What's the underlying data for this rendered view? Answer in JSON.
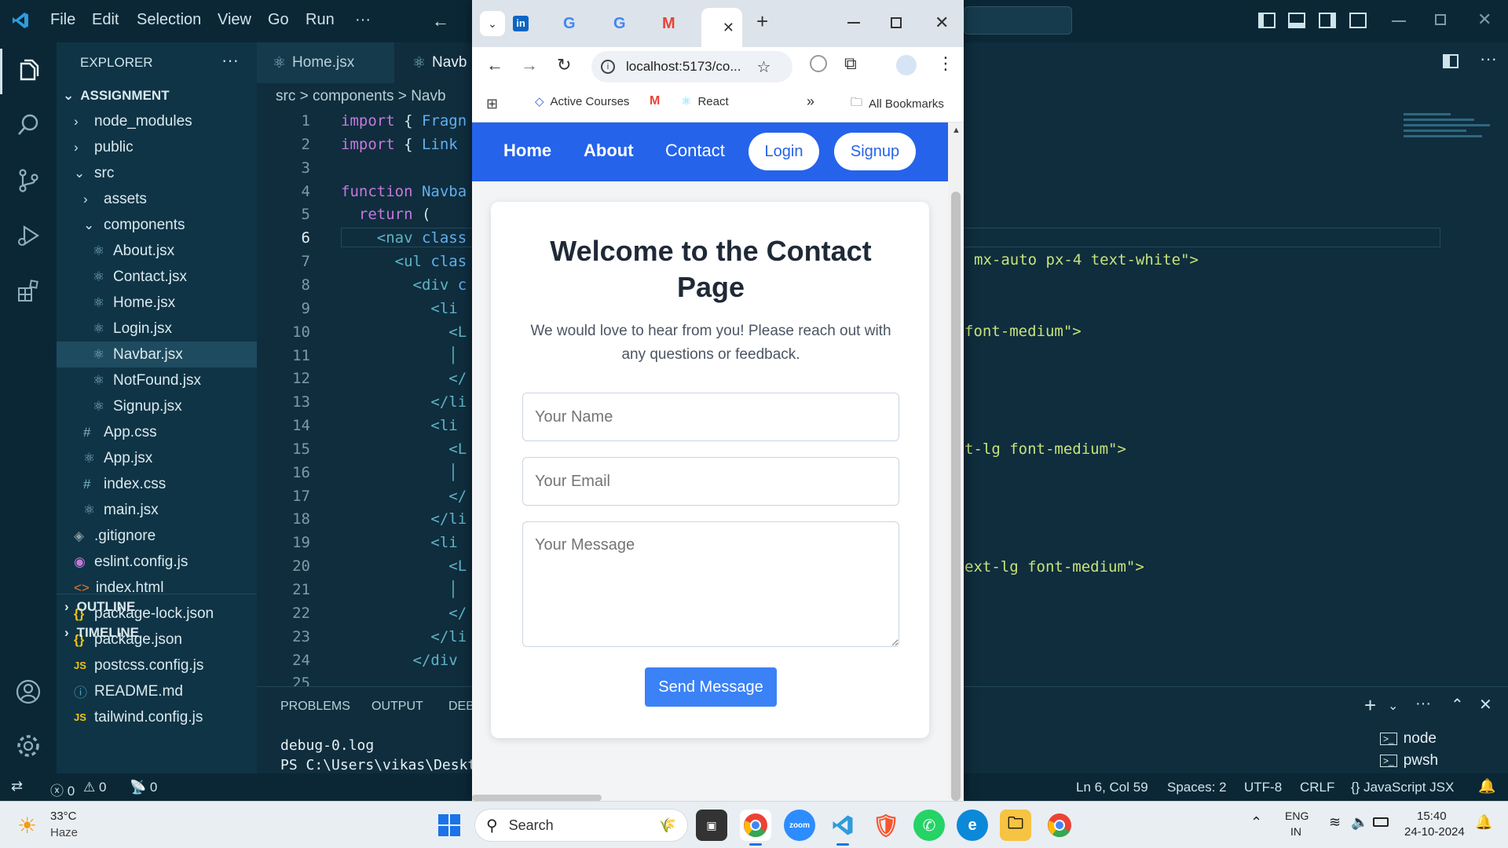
{
  "vscode": {
    "menu": [
      "File",
      "Edit",
      "Selection",
      "View",
      "Go",
      "Run",
      "···"
    ],
    "explorer_title": "EXPLORER",
    "explorer_more": "···",
    "project": "ASSIGNMENT",
    "tree": [
      {
        "label": "node_modules",
        "icon": "chevron-right"
      },
      {
        "label": "public",
        "icon": "chevron-right"
      },
      {
        "label": "src",
        "icon": "chevron-down"
      },
      {
        "label": "assets",
        "icon": "chevron-right"
      },
      {
        "label": "components",
        "icon": "chevron-down"
      },
      {
        "label": "About.jsx",
        "icon": "react"
      },
      {
        "label": "Contact.jsx",
        "icon": "react"
      },
      {
        "label": "Home.jsx",
        "icon": "react"
      },
      {
        "label": "Login.jsx",
        "icon": "react"
      },
      {
        "label": "Navbar.jsx",
        "icon": "react"
      },
      {
        "label": "NotFound.jsx",
        "icon": "react"
      },
      {
        "label": "Signup.jsx",
        "icon": "react"
      },
      {
        "label": "App.css",
        "icon": "hash"
      },
      {
        "label": "App.jsx",
        "icon": "react"
      },
      {
        "label": "index.css",
        "icon": "hash"
      },
      {
        "label": "main.jsx",
        "icon": "react"
      },
      {
        "label": ".gitignore",
        "icon": "diamond"
      },
      {
        "label": "eslint.config.js",
        "icon": "circle"
      },
      {
        "label": "index.html",
        "icon": "html"
      },
      {
        "label": "package-lock.json",
        "icon": "braces"
      },
      {
        "label": "package.json",
        "icon": "braces"
      },
      {
        "label": "postcss.config.js",
        "icon": "js"
      },
      {
        "label": "README.md",
        "icon": "info"
      },
      {
        "label": "tailwind.config.js",
        "icon": "js"
      }
    ],
    "outline": "OUTLINE",
    "timeline": "TIMELINE",
    "tabs": [
      "Home.jsx",
      "Navb"
    ],
    "breadcrumb": [
      "src",
      ">",
      "components",
      ">",
      "Navb"
    ],
    "line_numbers": [
      "1",
      "2",
      "3",
      "4",
      "5",
      "6",
      "7",
      "8",
      "9",
      "10",
      "11",
      "12",
      "13",
      "14",
      "15",
      "16",
      "17",
      "18",
      "19",
      "20",
      "21",
      "22",
      "23",
      "24",
      "25"
    ],
    "code_left": [
      [
        "import",
        " { ",
        "Fragn"
      ],
      [
        "import",
        " { ",
        "Link"
      ],
      [
        "",
        "",
        ""
      ],
      [
        "function",
        " ",
        "Navba"
      ],
      [
        "  return",
        " (",
        ""
      ],
      [
        "    <nav",
        " ",
        "class"
      ],
      [
        "      <ul",
        " ",
        "clas"
      ],
      [
        "        <div",
        " ",
        "c"
      ],
      [
        "          <li",
        "",
        ""
      ],
      [
        "            <L",
        "",
        ""
      ],
      [
        "            │",
        "",
        ""
      ],
      [
        "            </",
        "",
        ""
      ],
      [
        "          </li",
        "",
        ""
      ],
      [
        "          <li",
        "",
        ""
      ],
      [
        "            <L",
        "",
        ""
      ],
      [
        "            │",
        "",
        ""
      ],
      [
        "            </",
        "",
        ""
      ],
      [
        "          </li",
        "",
        ""
      ],
      [
        "          <li",
        "",
        ""
      ],
      [
        "            <L",
        "",
        ""
      ],
      [
        "            │",
        "",
        ""
      ],
      [
        "            </",
        "",
        ""
      ],
      [
        "          </li",
        "",
        ""
      ],
      [
        "        </div",
        "",
        ""
      ]
    ],
    "code_right": {
      "line7": "mx-auto px-4 text-white\">",
      "line10": "font-medium\">",
      "line15": "t-lg font-medium\">",
      "line20": "ext-lg font-medium\">"
    },
    "panel_tabs": [
      "PROBLEMS",
      "OUTPUT",
      "DEB"
    ],
    "terminal": [
      "debug-0.log",
      "PS C:\\Users\\vikas\\Deskt"
    ],
    "terminals": [
      "node",
      "pwsh"
    ],
    "status_left": [
      "0",
      "0",
      "0"
    ],
    "status_right": [
      "Ln 6, Col 59",
      "Spaces: 2",
      "UTF-8",
      "CRLF",
      "{} JavaScript JSX"
    ]
  },
  "browser": {
    "address": "localhost:5173/co...",
    "bookmarks": [
      "Active Courses",
      "React",
      "All Bookmarks"
    ],
    "bookmarks_more": "»",
    "tab_new": "+",
    "nav": {
      "links": [
        "Home",
        "About",
        "Contact"
      ],
      "login": "Login",
      "signup": "Signup"
    },
    "page": {
      "title": "Welcome to the Contact Page",
      "subtitle": "We would love to hear from you! Please reach out with any questions or feedback.",
      "name_placeholder": "Your Name",
      "email_placeholder": "Your Email",
      "message_placeholder": "Your Message",
      "submit": "Send Message"
    }
  },
  "taskbar": {
    "weather_temp": "33°C",
    "weather_desc": "Haze",
    "search": "Search",
    "lang_top": "ENG",
    "lang_bottom": "IN",
    "time": "15:40",
    "date": "24-10-2024"
  },
  "colors": {
    "nav_blue": "#2563eb",
    "button_blue": "#3b82f6",
    "vscode_bg": "#0f2d3d"
  }
}
